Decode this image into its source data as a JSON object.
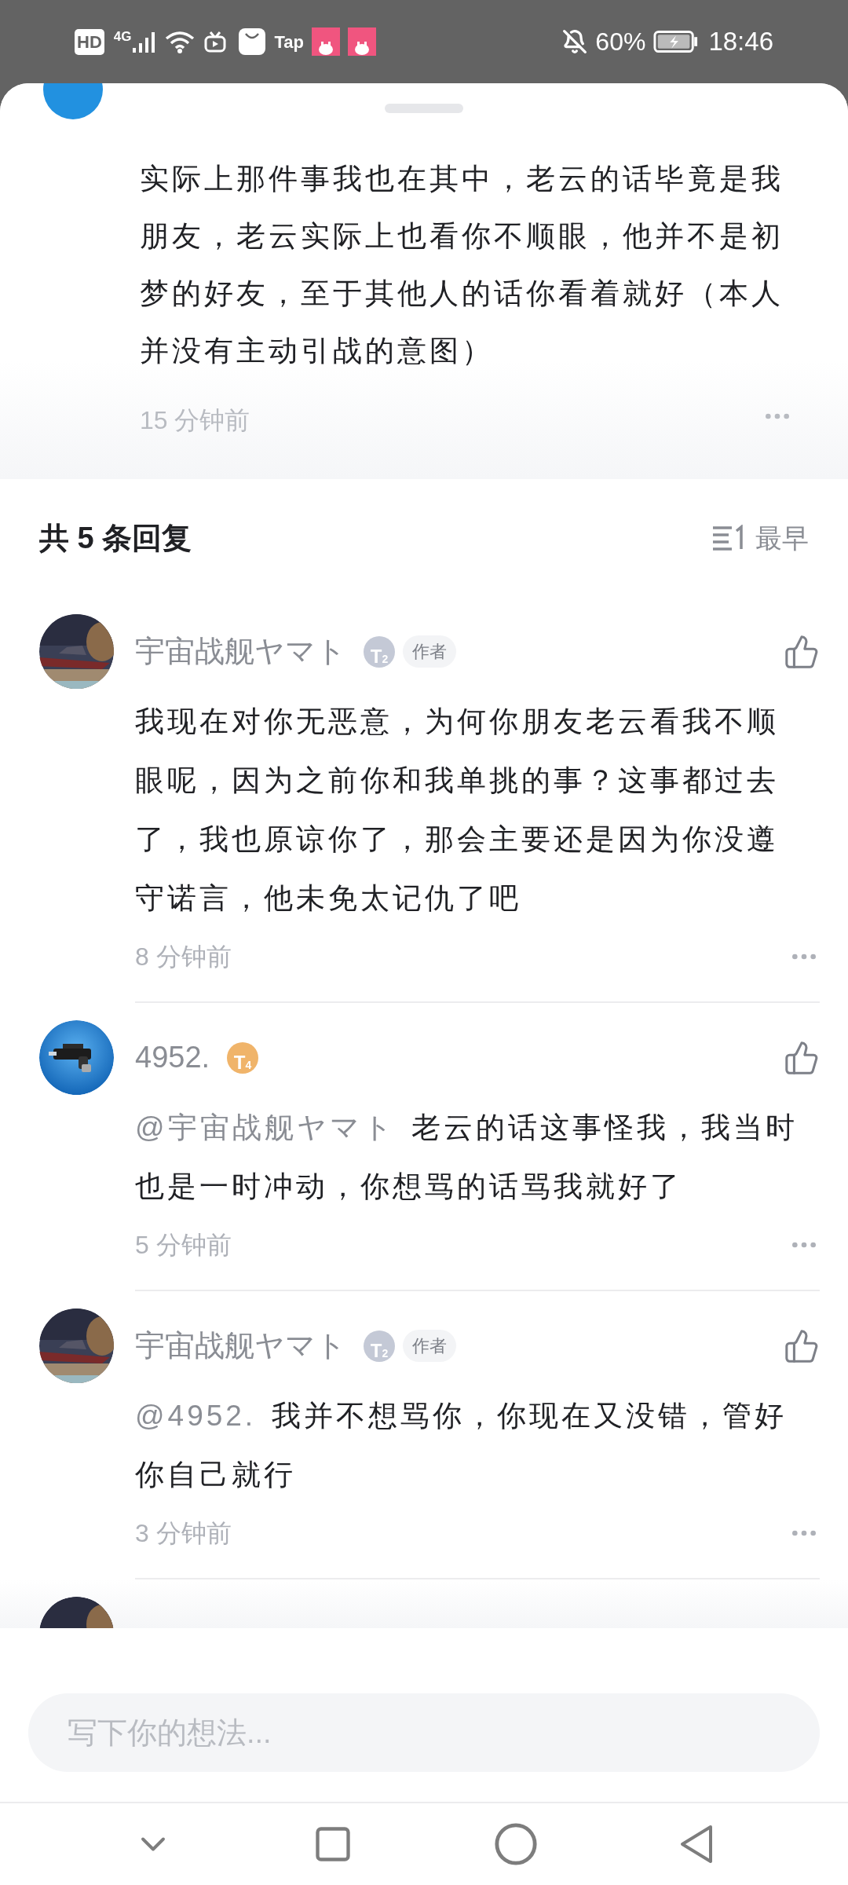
{
  "status_bar": {
    "hd": "HD",
    "network": "4G",
    "tap": "Tap",
    "battery": "60%",
    "time": "18:46"
  },
  "parent_comment": {
    "text": "实际上那件事我也在其中，老云的话毕竟是我朋友，老云实际上也看你不顺眼，他并不是初梦的好友，至于其他人的话你看着就好（本人并没有主动引战的意图）",
    "time": "15 分钟前"
  },
  "replies_header": {
    "title": "共 5 条回复",
    "sort": "最早"
  },
  "replies": [
    {
      "name": "宇宙战舰ヤマト",
      "badge": {
        "letter": "T",
        "sub": "2",
        "color": "#c4c9d6"
      },
      "tag": "作者",
      "content": "我现在对你无恶意，为何你朋友老云看我不顺眼呢，因为之前你和我单挑的事？这事都过去了，我也原谅你了，那会主要还是因为你没遵守诺言，他未免太记仇了吧",
      "time": "8 分钟前"
    },
    {
      "name": "4952.",
      "badge": {
        "letter": "T",
        "sub": "4",
        "color": "#f0b46a"
      },
      "mention": "@宇宙战舰ヤマト",
      "content": "老云的话这事怪我，我当时也是一时冲动，你想骂的话骂我就好了",
      "time": "5 分钟前"
    },
    {
      "name": "宇宙战舰ヤマト",
      "badge": {
        "letter": "T",
        "sub": "2",
        "color": "#c4c9d6"
      },
      "tag": "作者",
      "mention": "@4952.",
      "content": "我并不想骂你，你现在又没错，管好你自己就行",
      "time": "3 分钟前"
    }
  ],
  "input": {
    "placeholder": "写下你的想法..."
  }
}
